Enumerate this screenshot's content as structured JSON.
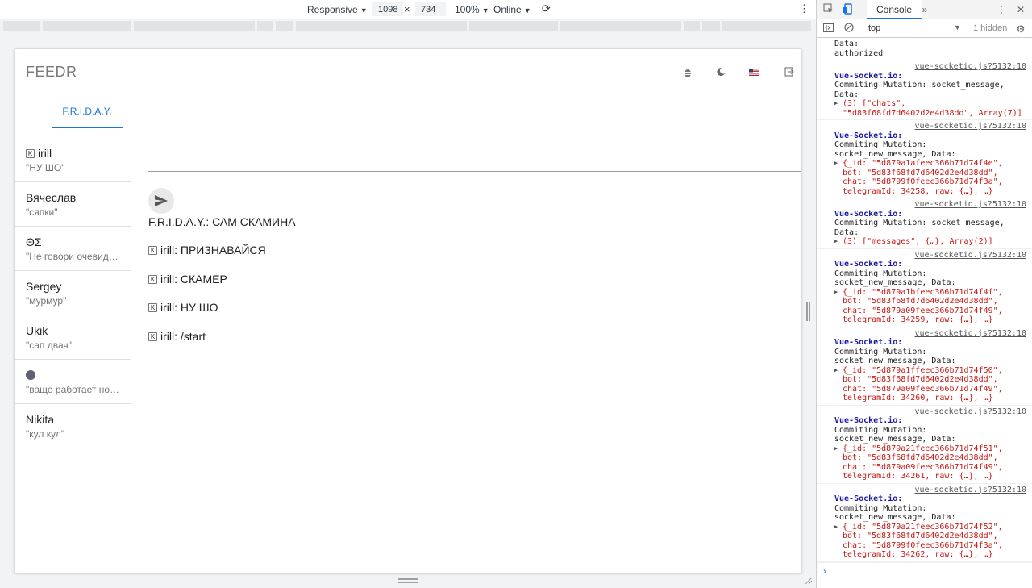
{
  "toolbar": {
    "device": "Responsive",
    "width": "1098",
    "times": "×",
    "height": "734",
    "zoom": "100%",
    "network": "Online"
  },
  "app": {
    "brand": "FEEDR",
    "tab_label": "F.R.I.D.A.Y.",
    "chats": [
      {
        "name": "irill",
        "preview": "\"НУ ШО\"",
        "badge": "K"
      },
      {
        "name": "Вячеслав",
        "preview": "\"сяпки\""
      },
      {
        "name": "ΘΣ",
        "preview": "\"Не говори очевидное\""
      },
      {
        "name": "Sergey",
        "preview": "\"мурмур\""
      },
      {
        "name": "Ukik",
        "preview": "\"сап двач\""
      },
      {
        "name": "",
        "preview": "\"ваще работает норм\"",
        "avatar": true
      },
      {
        "name": "Nikita",
        "preview": "\"кул кул\""
      }
    ],
    "messages": [
      {
        "text": "F.R.I.D.A.Y.: САМ СКАМИНА"
      },
      {
        "text": "irill: ПРИЗНАВАЙСЯ",
        "badge": "K"
      },
      {
        "text": "irill: СКАМЕР",
        "badge": "K"
      },
      {
        "text": "irill: НУ ШО",
        "badge": "K"
      },
      {
        "text": "irill: /start",
        "badge": "K"
      }
    ]
  },
  "devtools": {
    "tab_console": "Console",
    "context": "top",
    "hidden": "1 hidden",
    "log_top": [
      "Data:",
      "authorized"
    ],
    "source": "vue-socketio.js?5132:10",
    "tag": "Vue-Socket.io:",
    "entries": [
      {
        "line1": "Commiting Mutation: socket_message,",
        "line2": "Data:",
        "obj": "(3) [\"chats\", \"5d83f68fd7d6402d2e4d38dd\", Array(7)]"
      },
      {
        "line1": "Commiting Mutation:",
        "line2": "socket_new_message, Data:",
        "obj": "{_id: \"5d879a1afeec366b71d74f4e\", bot: \"5d83f68fd7d6402d2e4d38dd\", chat: \"5d8799f0feec366b71d74f3a\", telegramId: 34258, raw: {…}, …}"
      },
      {
        "line1": "Commiting Mutation: socket_message,",
        "line2": "Data:",
        "obj": "(3) [\"messages\", {…}, Array(2)]"
      },
      {
        "line1": "Commiting Mutation:",
        "line2": "socket_new_message, Data:",
        "obj": "{_id: \"5d879a1bfeec366b71d74f4f\", bot: \"5d83f68fd7d6402d2e4d38dd\", chat: \"5d879a09feec366b71d74f49\", telegramId: 34259, raw: {…}, …}"
      },
      {
        "line1": "Commiting Mutation:",
        "line2": "socket_new_message, Data:",
        "obj": "{_id: \"5d879a1ffeec366b71d74f50\", bot: \"5d83f68fd7d6402d2e4d38dd\", chat: \"5d879a09feec366b71d74f49\", telegramId: 34260, raw: {…}, …}"
      },
      {
        "line1": "Commiting Mutation:",
        "line2": "socket_new_message, Data:",
        "obj": "{_id: \"5d879a21feec366b71d74f51\", bot: \"5d83f68fd7d6402d2e4d38dd\", chat: \"5d879a09feec366b71d74f49\", telegramId: 34261, raw: {…}, …}"
      },
      {
        "line1": "Commiting Mutation:",
        "line2": "socket_new_message, Data:",
        "obj": "{_id: \"5d879a21feec366b71d74f52\", bot: \"5d83f68fd7d6402d2e4d38dd\", chat: \"5d8799f0feec366b71d74f3a\", telegramId: 34262, raw: {…}, …}"
      }
    ],
    "prompt": "›"
  }
}
